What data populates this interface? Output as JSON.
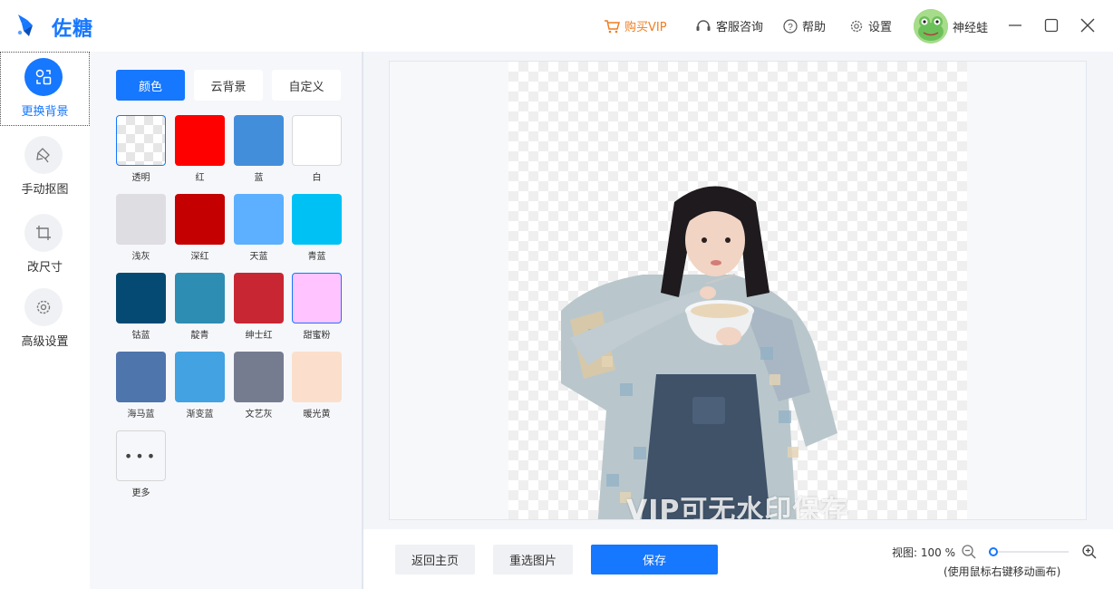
{
  "app": {
    "name": "佐糖",
    "brand_color": "#1677ff"
  },
  "titlebar": {
    "vip_label": "购买VIP",
    "support_label": "客服咨询",
    "help_label": "帮助",
    "settings_label": "设置",
    "username": "神经蛙",
    "icons": [
      "cart-icon",
      "headset-icon",
      "question-icon",
      "gear-icon",
      "minimize-icon",
      "maximize-icon",
      "close-icon"
    ]
  },
  "rail": {
    "items": [
      {
        "label": "更换背景",
        "icon": "swap-background-icon",
        "active": true
      },
      {
        "label": "手动抠图",
        "icon": "manual-cutout-icon",
        "active": false
      },
      {
        "label": "改尺寸",
        "icon": "crop-icon",
        "active": false
      },
      {
        "label": "高级设置",
        "icon": "advanced-settings-icon",
        "active": false
      }
    ]
  },
  "panel": {
    "tabs": [
      {
        "label": "颜色",
        "active": true
      },
      {
        "label": "云背景",
        "active": false
      },
      {
        "label": "自定义",
        "active": false
      }
    ],
    "swatches": [
      {
        "label": "透明",
        "color": "transparent"
      },
      {
        "label": "红",
        "color": "#ff0000"
      },
      {
        "label": "蓝",
        "color": "#438edb"
      },
      {
        "label": "白",
        "color": "#ffffff"
      },
      {
        "label": "浅灰",
        "color": "#dedde2"
      },
      {
        "label": "深红",
        "color": "#c40000"
      },
      {
        "label": "天蓝",
        "color": "#5cb0ff"
      },
      {
        "label": "青蓝",
        "color": "#00c1f4"
      },
      {
        "label": "钴蓝",
        "color": "#054a73"
      },
      {
        "label": "靛青",
        "color": "#2e8db3"
      },
      {
        "label": "绅士红",
        "color": "#c92633"
      },
      {
        "label": "甜蜜粉",
        "color": "#ffc4ff"
      },
      {
        "label": "海马蓝",
        "color": "#4e75ac"
      },
      {
        "label": "渐变蓝",
        "color": "#43a2e2"
      },
      {
        "label": "文艺灰",
        "color": "#767c90"
      },
      {
        "label": "暖光黄",
        "color": "#fbdfcc"
      },
      {
        "label": "更多",
        "color": "more"
      }
    ]
  },
  "canvas": {
    "watermark": "VIP可无水印保存"
  },
  "bottom": {
    "back_label": "返回主页",
    "reselect_label": "重选图片",
    "save_label": "保存",
    "zoom_text": "视图: 100 %",
    "zoom_hint": "(使用鼠标右键移动画布)",
    "zoom_level": 0.06
  }
}
